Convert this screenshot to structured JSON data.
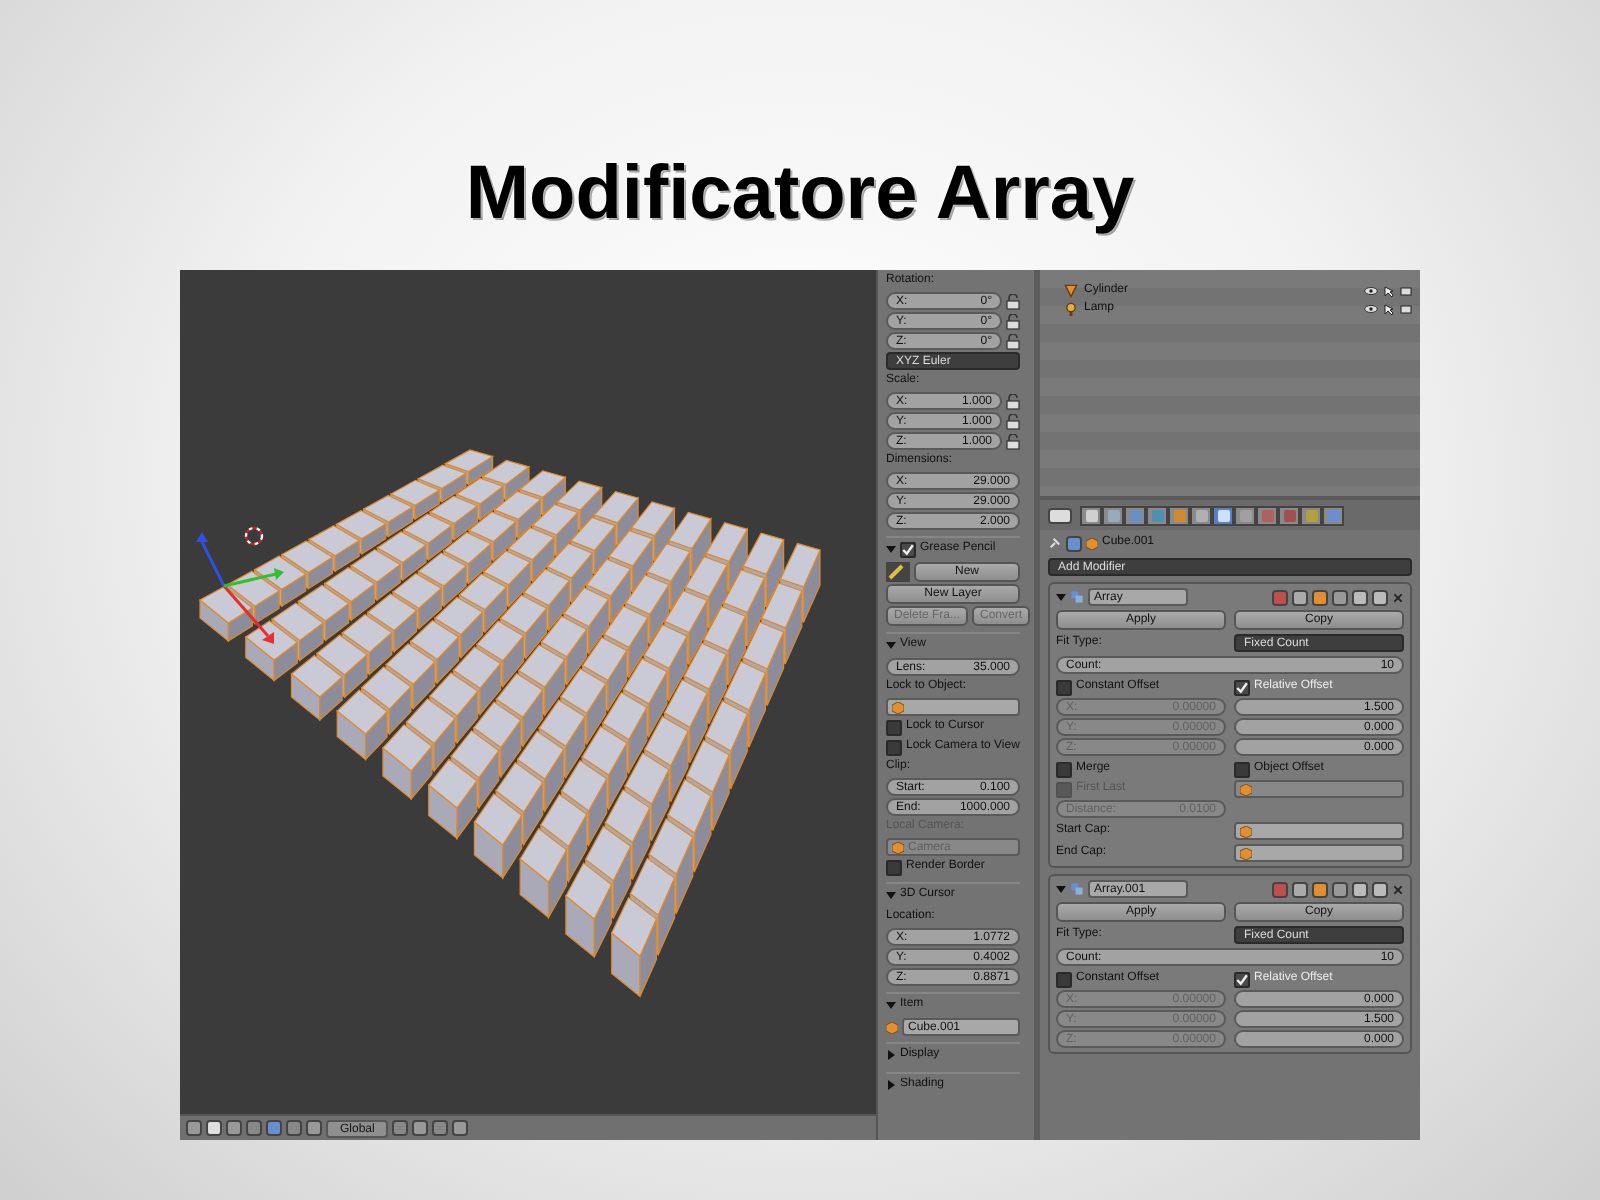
{
  "slide": {
    "title": "Modificatore Array"
  },
  "viewport": {
    "orientation": "Global"
  },
  "n_panel": {
    "rotation": {
      "label": "Rotation:",
      "fields": [
        {
          "axis": "X:",
          "value": "0°"
        },
        {
          "axis": "Y:",
          "value": "0°"
        },
        {
          "axis": "Z:",
          "value": "0°"
        }
      ]
    },
    "rotation_mode": "XYZ Euler",
    "scale": {
      "label": "Scale:",
      "fields": [
        {
          "axis": "X:",
          "value": "1.000"
        },
        {
          "axis": "Y:",
          "value": "1.000"
        },
        {
          "axis": "Z:",
          "value": "1.000"
        }
      ]
    },
    "dimensions": {
      "label": "Dimensions:",
      "fields": [
        {
          "axis": "X:",
          "value": "29.000"
        },
        {
          "axis": "Y:",
          "value": "29.000"
        },
        {
          "axis": "Z:",
          "value": "2.000"
        }
      ]
    },
    "grease_pencil": {
      "label": "Grease Pencil",
      "expanded": true,
      "checked": true,
      "new": "New",
      "new_layer": "New Layer",
      "delete_frame": "Delete Fra...",
      "convert": "Convert"
    },
    "view": {
      "label": "View",
      "expanded": true,
      "lens": {
        "axis": "Lens:",
        "value": "35.000"
      },
      "lock_to_object": "Lock to Object:",
      "lock_to_cursor": {
        "label": "Lock to Cursor",
        "checked": false
      },
      "lock_camera_to_view": {
        "label": "Lock Camera to View",
        "checked": false
      },
      "clip": "Clip:",
      "clip_fields": [
        {
          "axis": "Start:",
          "value": "0.100"
        },
        {
          "axis": "End:",
          "value": "1000.000"
        }
      ],
      "local_camera": {
        "label": "Local Camera:",
        "value": "Camera",
        "disabled": true
      },
      "render_border": {
        "label": "Render Border",
        "checked": false
      }
    },
    "cursor": {
      "label": "3D Cursor",
      "expanded": true,
      "location": "Location:",
      "fields": [
        {
          "axis": "X:",
          "value": "1.0772"
        },
        {
          "axis": "Y:",
          "value": "0.4002"
        },
        {
          "axis": "Z:",
          "value": "0.8871"
        }
      ]
    },
    "item": {
      "label": "Item",
      "expanded": true,
      "name": "Cube.001"
    },
    "collapsed_panels": [
      {
        "label": "Display",
        "expanded": false
      },
      {
        "label": "Shading",
        "expanded": false
      }
    ]
  },
  "outliner": {
    "items": [
      {
        "name": "Cylinder",
        "kind": "mesh"
      },
      {
        "name": "Lamp",
        "kind": "lamp"
      }
    ]
  },
  "properties": {
    "tabs": [
      {
        "kind": "render",
        "selected": false
      },
      {
        "kind": "layers",
        "selected": false
      },
      {
        "kind": "scene",
        "selected": false
      },
      {
        "kind": "world",
        "selected": false
      },
      {
        "kind": "object",
        "selected": false
      },
      {
        "kind": "constraints",
        "selected": false
      },
      {
        "kind": "modifiers",
        "selected": true
      },
      {
        "kind": "data",
        "selected": false
      },
      {
        "kind": "material",
        "selected": false
      },
      {
        "kind": "texture",
        "selected": false
      },
      {
        "kind": "particles",
        "selected": false
      },
      {
        "kind": "physics",
        "selected": false
      }
    ],
    "object_name": "Cube.001",
    "add_modifier": "Add Modifier",
    "modifiers": [
      {
        "name": "Array",
        "apply": "Apply",
        "copy": "Copy",
        "fit_type_label": "Fit Type:",
        "fit_type": "Fixed Count",
        "count": {
          "axis": "Count:",
          "value": "10"
        },
        "constant_offset": {
          "label": "Constant Offset",
          "checked": false,
          "fields": [
            {
              "axis": "X:",
              "value": "0.00000"
            },
            {
              "axis": "Y:",
              "value": "0.00000"
            },
            {
              "axis": "Z:",
              "value": "0.00000"
            }
          ]
        },
        "relative_offset": {
          "label": "Relative Offset",
          "checked": true,
          "values": [
            "1.500",
            "0.000",
            "0.000"
          ]
        },
        "merge": {
          "label": "Merge",
          "checked": false
        },
        "first_last": {
          "label": "First Last",
          "checked": false,
          "disabled": true
        },
        "distance": {
          "axis": "Distance:",
          "value": "0.0100"
        },
        "object_offset": {
          "label": "Object Offset",
          "checked": false
        },
        "start_cap": "Start Cap:",
        "end_cap": "End Cap:"
      },
      {
        "name": "Array.001",
        "apply": "Apply",
        "copy": "Copy",
        "fit_type_label": "Fit Type:",
        "fit_type": "Fixed Count",
        "count": {
          "axis": "Count:",
          "value": "10"
        },
        "constant_offset": {
          "label": "Constant Offset",
          "checked": false,
          "fields": [
            {
              "axis": "X:",
              "value": "0.00000"
            },
            {
              "axis": "Y:",
              "value": "0.00000"
            },
            {
              "axis": "Z:",
              "value": "0.00000"
            }
          ]
        },
        "relative_offset": {
          "label": "Relative Offset",
          "checked": true,
          "values": [
            "0.000",
            "1.500",
            "0.000"
          ]
        }
      }
    ]
  }
}
